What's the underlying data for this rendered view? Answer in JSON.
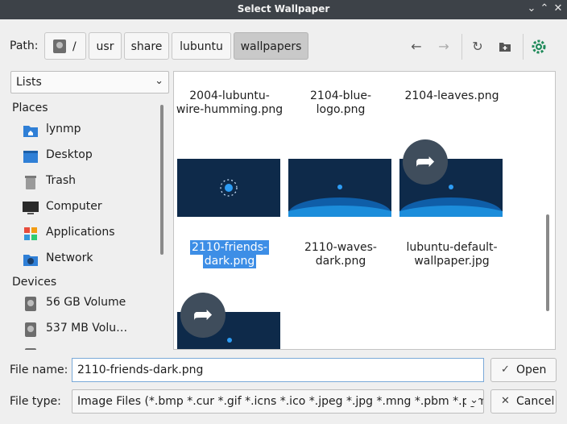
{
  "window": {
    "title": "Select Wallpaper"
  },
  "path": {
    "label": "Path:",
    "crumbs": [
      "/",
      "usr",
      "share",
      "lubuntu",
      "wallpapers"
    ]
  },
  "view_mode": "Lists",
  "sidebar": {
    "places_header": "Places",
    "places": [
      "lynmp",
      "Desktop",
      "Trash",
      "Computer",
      "Applications",
      "Network"
    ],
    "devices_header": "Devices",
    "devices": [
      "56 GB Volume",
      "537 MB Volu…"
    ]
  },
  "files": [
    {
      "name1": "2004-lubuntu-",
      "name2": "wire-humming.png"
    },
    {
      "name1": "2104-blue-",
      "name2": "logo.png"
    },
    {
      "name1": "2104-leaves.png",
      "name2": ""
    },
    {
      "name1": "2110-friends-",
      "name2": "dark.png"
    },
    {
      "name1": "2110-waves-",
      "name2": "dark.png"
    },
    {
      "name1": "lubuntu-default-",
      "name2": "wallpaper.jpg"
    }
  ],
  "form": {
    "filename_label": "File name:",
    "filename_value": "2110-friends-dark.png",
    "filetype_label": "File type:",
    "filetype_value": "Image Files (*.bmp *.cur *.gif *.icns *.ico *.jpeg *.jpg *.mng *.pbm *.pgm",
    "open_label": "Open",
    "cancel_label": "Cancel"
  },
  "colors": {
    "selection": "#3d8ee6",
    "titlebar": "#3d4248",
    "thumbnail_bg": "#0e2a4a"
  }
}
